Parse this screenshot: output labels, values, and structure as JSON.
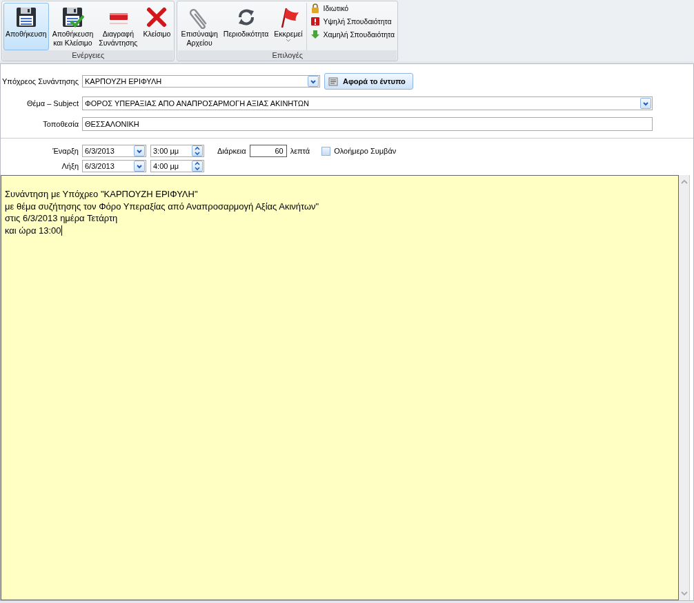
{
  "ribbon": {
    "groups": [
      {
        "label": "Ενέργειες",
        "buttons": [
          {
            "label": "Αποθήκευση",
            "selected": true
          },
          {
            "label": "Αποθήκευση\nκαι Κλείσιμο",
            "selected": false
          },
          {
            "label": "Διαγραφή\nΣυνάντησης",
            "selected": false
          },
          {
            "label": "Κλείσιμο",
            "selected": false
          }
        ]
      },
      {
        "label": "Επιλογές",
        "buttons": [
          {
            "label": "Επισύναψη\nΑρχείου",
            "selected": false
          },
          {
            "label": "Περιοδικότητα",
            "selected": false
          },
          {
            "label": "Εκκρεμεί",
            "selected": false,
            "kind": "dropdown"
          }
        ],
        "small_buttons": [
          {
            "label": "Ιδιωτικό"
          },
          {
            "label": "Υψηλή Σπουδαιότητα"
          },
          {
            "label": "Χαμηλή Σπουδαιότητα"
          }
        ]
      }
    ]
  },
  "fields": [
    {
      "label": "Υπόχρεος Συνάντησης",
      "value": "ΚΑΡΠΟΥΖΗ ΕΡΙΦΥΛΗ",
      "kind": "combo",
      "button": "Αφορά το έντυπο"
    },
    {
      "label": "Θέμα – Subject",
      "value": "ΦΟΡΟΣ ΥΠΕΡΑΞΙΑΣ ΑΠΟ ΑΝΑΠΡΟΣΑΡΜΟΓΗ ΑΞΙΑΣ ΑΚΙΝΗΤΩΝ",
      "kind": "combo"
    },
    {
      "label": "Τοποθεσία",
      "value": "ΘΕΣΣΑΛΟΝΙΚΗ",
      "kind": "text"
    }
  ],
  "schedule": [
    {
      "label": "Έναρξη",
      "date": "6/3/2013",
      "time": "3:00 μμ"
    },
    {
      "label": "Λήξη",
      "date": "6/3/2013",
      "time": "4:00 μμ"
    }
  ],
  "duration": {
    "label": "Διάρκεια",
    "value": "60",
    "unit": "λεπτά"
  },
  "all_day": {
    "label": "Ολοήμερο Συμβάν",
    "checked": false
  },
  "notes": {
    "lines": [
      "Συνάντηση με Υπόχρεο \"ΚΑΡΠΟΥΖΗ ΕΡΙΦΥΛΗ\"",
      "με θέμα συζήτησης τον Φόρο Υπεραξίας από Αναπροσαρμογή Αξίας Ακινήτων\"",
      "στις 6/3/2013 ημέρα Τετάρτη",
      "και ώρα 13:00"
    ]
  }
}
